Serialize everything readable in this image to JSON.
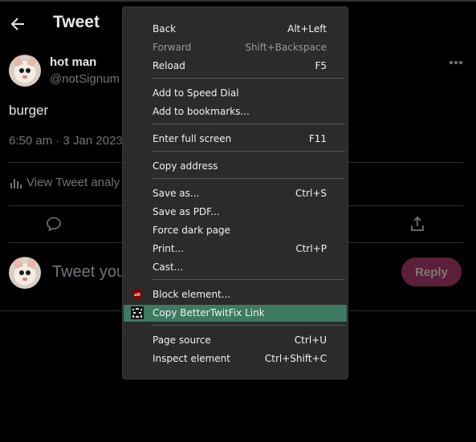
{
  "header": {
    "title": "Tweet"
  },
  "tweet": {
    "author_name": "hot man",
    "author_handle": "@notSignum",
    "text": "burger",
    "timestamp": "6:50 am · 3 Jan 2023",
    "analytics_label": "View Tweet analy"
  },
  "reply": {
    "placeholder": "Tweet you",
    "button_label": "Reply"
  },
  "context_menu": {
    "items": [
      {
        "label": "Back",
        "shortcut": "Alt+Left"
      },
      {
        "label": "Forward",
        "shortcut": "Shift+Backspace",
        "disabled": true
      },
      {
        "label": "Reload",
        "shortcut": "F5"
      },
      {
        "label": "Add to Speed Dial",
        "shortcut": ""
      },
      {
        "label": "Add to bookmarks...",
        "shortcut": ""
      },
      {
        "label": "Enter full screen",
        "shortcut": "F11"
      },
      {
        "label": "Copy address",
        "shortcut": ""
      },
      {
        "label": "Save as...",
        "shortcut": "Ctrl+S"
      },
      {
        "label": "Save as PDF...",
        "shortcut": ""
      },
      {
        "label": "Force dark page",
        "shortcut": ""
      },
      {
        "label": "Print...",
        "shortcut": "Ctrl+P"
      },
      {
        "label": "Cast...",
        "shortcut": ""
      },
      {
        "label": "Block element...",
        "shortcut": "",
        "icon": "ublock-icon"
      },
      {
        "label": "Copy BetterTwitFix Link",
        "shortcut": "",
        "icon": "bettertwitfix-icon",
        "highlighted": true
      },
      {
        "label": "Page source",
        "shortcut": "Ctrl+U"
      },
      {
        "label": "Inspect element",
        "shortcut": "Ctrl+Shift+C"
      }
    ]
  },
  "colors": {
    "background": "#000000",
    "menu_background": "#2b2b2b",
    "menu_highlight": "#3d7a61",
    "reply_button": "#5c1f3b",
    "muted_text": "#71767b"
  }
}
